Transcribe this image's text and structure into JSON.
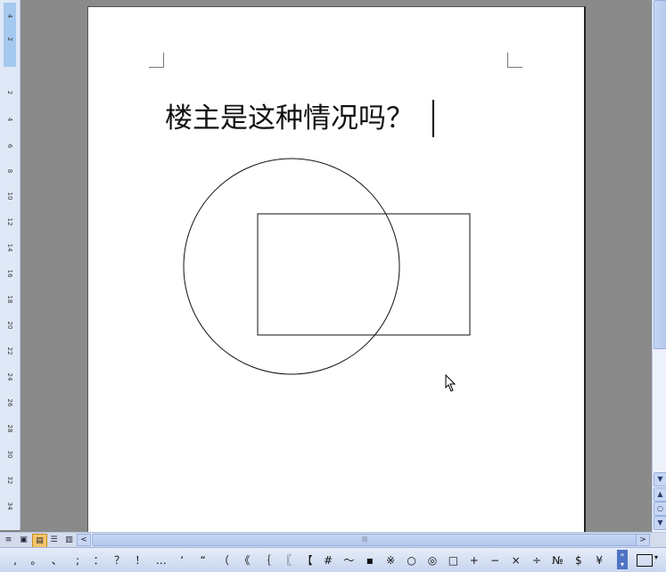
{
  "document": {
    "text": "楼主是这种情况吗？"
  },
  "ruler": {
    "labels": [
      "4",
      "2",
      "2",
      "4",
      "6",
      "8",
      "10",
      "12",
      "14",
      "16",
      "18",
      "20",
      "22",
      "24",
      "26",
      "28",
      "30",
      "32",
      "34"
    ]
  },
  "view_buttons": [
    {
      "name": "normal-view",
      "glyph": "≡"
    },
    {
      "name": "web-view",
      "glyph": "▣"
    },
    {
      "name": "print-view",
      "glyph": "▤"
    },
    {
      "name": "outline-view",
      "glyph": "☰"
    },
    {
      "name": "reading-view",
      "glyph": "▥"
    }
  ],
  "symbols": [
    ",",
    "。",
    "、",
    ";",
    "：",
    "？",
    "！",
    "…",
    "‘",
    "“",
    "（",
    "《",
    "｛",
    "〖",
    "【",
    "#",
    "～",
    "▪",
    "※",
    "○",
    "◎",
    "□",
    "+",
    "−",
    "×",
    "÷",
    "№",
    "$",
    "¥"
  ],
  "scroll": {
    "up": "▲",
    "down": "▼",
    "prev_page": "▲",
    "select_browse": "○",
    "next_page": "▼",
    "left": "<",
    "right": ">",
    "grip": "|||"
  },
  "colors": {
    "page": "#ffffff",
    "workspace": "#8a8a8a",
    "toolbar": "#d4dcec"
  }
}
